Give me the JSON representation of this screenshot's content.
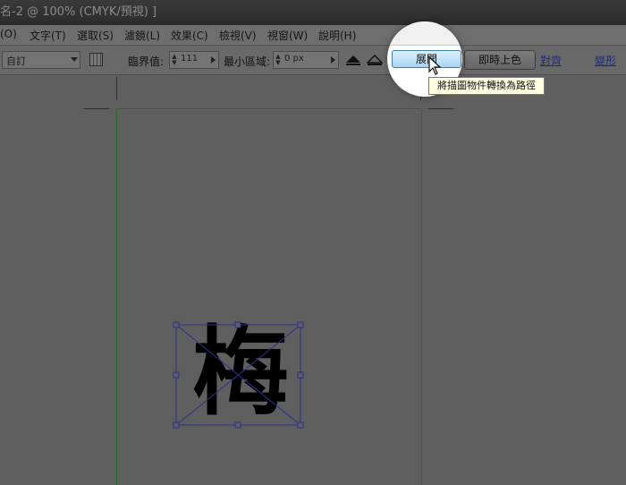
{
  "window": {
    "title": "名-2 @ 100% (CMYK/預視) ]"
  },
  "menu": {
    "items": [
      "(O)",
      "文字(T)",
      "選取(S)",
      "濾鏡(L)",
      "效果(C)",
      "檢視(V)",
      "視窗(W)",
      "說明(H)"
    ]
  },
  "controlbar": {
    "preset": "自訂",
    "threshold_label": "臨界值:",
    "threshold_value": "111",
    "min_area_label": "最小區域:",
    "min_area_value": "0 px",
    "expand_button": "展開",
    "live_paint_button": "即時上色",
    "align_link": "對齊",
    "transform_link": "變形",
    "icons": [
      "grid-icon",
      "mountain-icon",
      "triangle-outline-icon"
    ]
  },
  "tooltip": "將描圖物件轉換為路徑",
  "artwork": {
    "glyph": "梅"
  },
  "colors": {
    "canvas": "#5f5f5f",
    "artboard_border": "#2d6a2d",
    "selection": "#2d2f8c",
    "expand_button": "#a7d4f3"
  }
}
